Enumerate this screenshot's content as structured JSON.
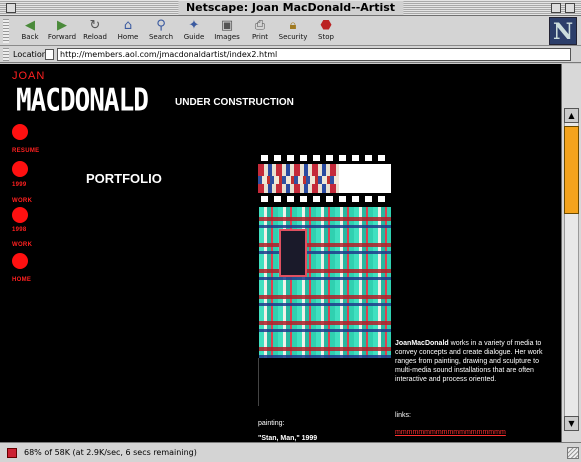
{
  "window": {
    "title": "Netscape: Joan MacDonald--Artist"
  },
  "toolbar": {
    "buttons": [
      {
        "label": "Back",
        "icon": "back-arrow-icon"
      },
      {
        "label": "Forward",
        "icon": "forward-arrow-icon"
      },
      {
        "label": "Reload",
        "icon": "reload-icon"
      },
      {
        "label": "Home",
        "icon": "home-icon"
      },
      {
        "label": "Search",
        "icon": "search-icon"
      },
      {
        "label": "Guide",
        "icon": "guide-icon"
      },
      {
        "label": "Images",
        "icon": "images-icon"
      },
      {
        "label": "Print",
        "icon": "print-icon"
      },
      {
        "label": "Security",
        "icon": "security-lock-icon"
      },
      {
        "label": "Stop",
        "icon": "stop-icon"
      }
    ],
    "logo": "N"
  },
  "location": {
    "label": "Location:",
    "url": "http://members.aol.com/jmacdonaldartist/index2.html"
  },
  "page": {
    "first_name": "JOAN",
    "last_name": "MACDONALD",
    "under_construction": "UNDER CONSTRUCTION",
    "portfolio": "PORTFOLIO",
    "nav": [
      "RESUME",
      "1999",
      "WORK",
      "1998",
      "WORK",
      "HOME"
    ],
    "bio_name": "JoanMacDonald",
    "bio_text": " works in a variety of media to convey concepts and create dialogue. Her work ranges from painting, drawing and sculpture to multi-media sound installations that are often interactive and process oriented.",
    "links_label": "links:",
    "link_text": "mmmmmmmmmmmmmmmmmmm",
    "painting_label": "painting:",
    "painting_title": "\"Stan, Man,\" 1999"
  },
  "status": {
    "text": "68% of 58K (at 2.9K/sec, 6 secs remaining)"
  },
  "colors": {
    "accent_red": "#ff2020",
    "scroll_thumb": "#f4a31c",
    "page_bg": "#000000"
  }
}
